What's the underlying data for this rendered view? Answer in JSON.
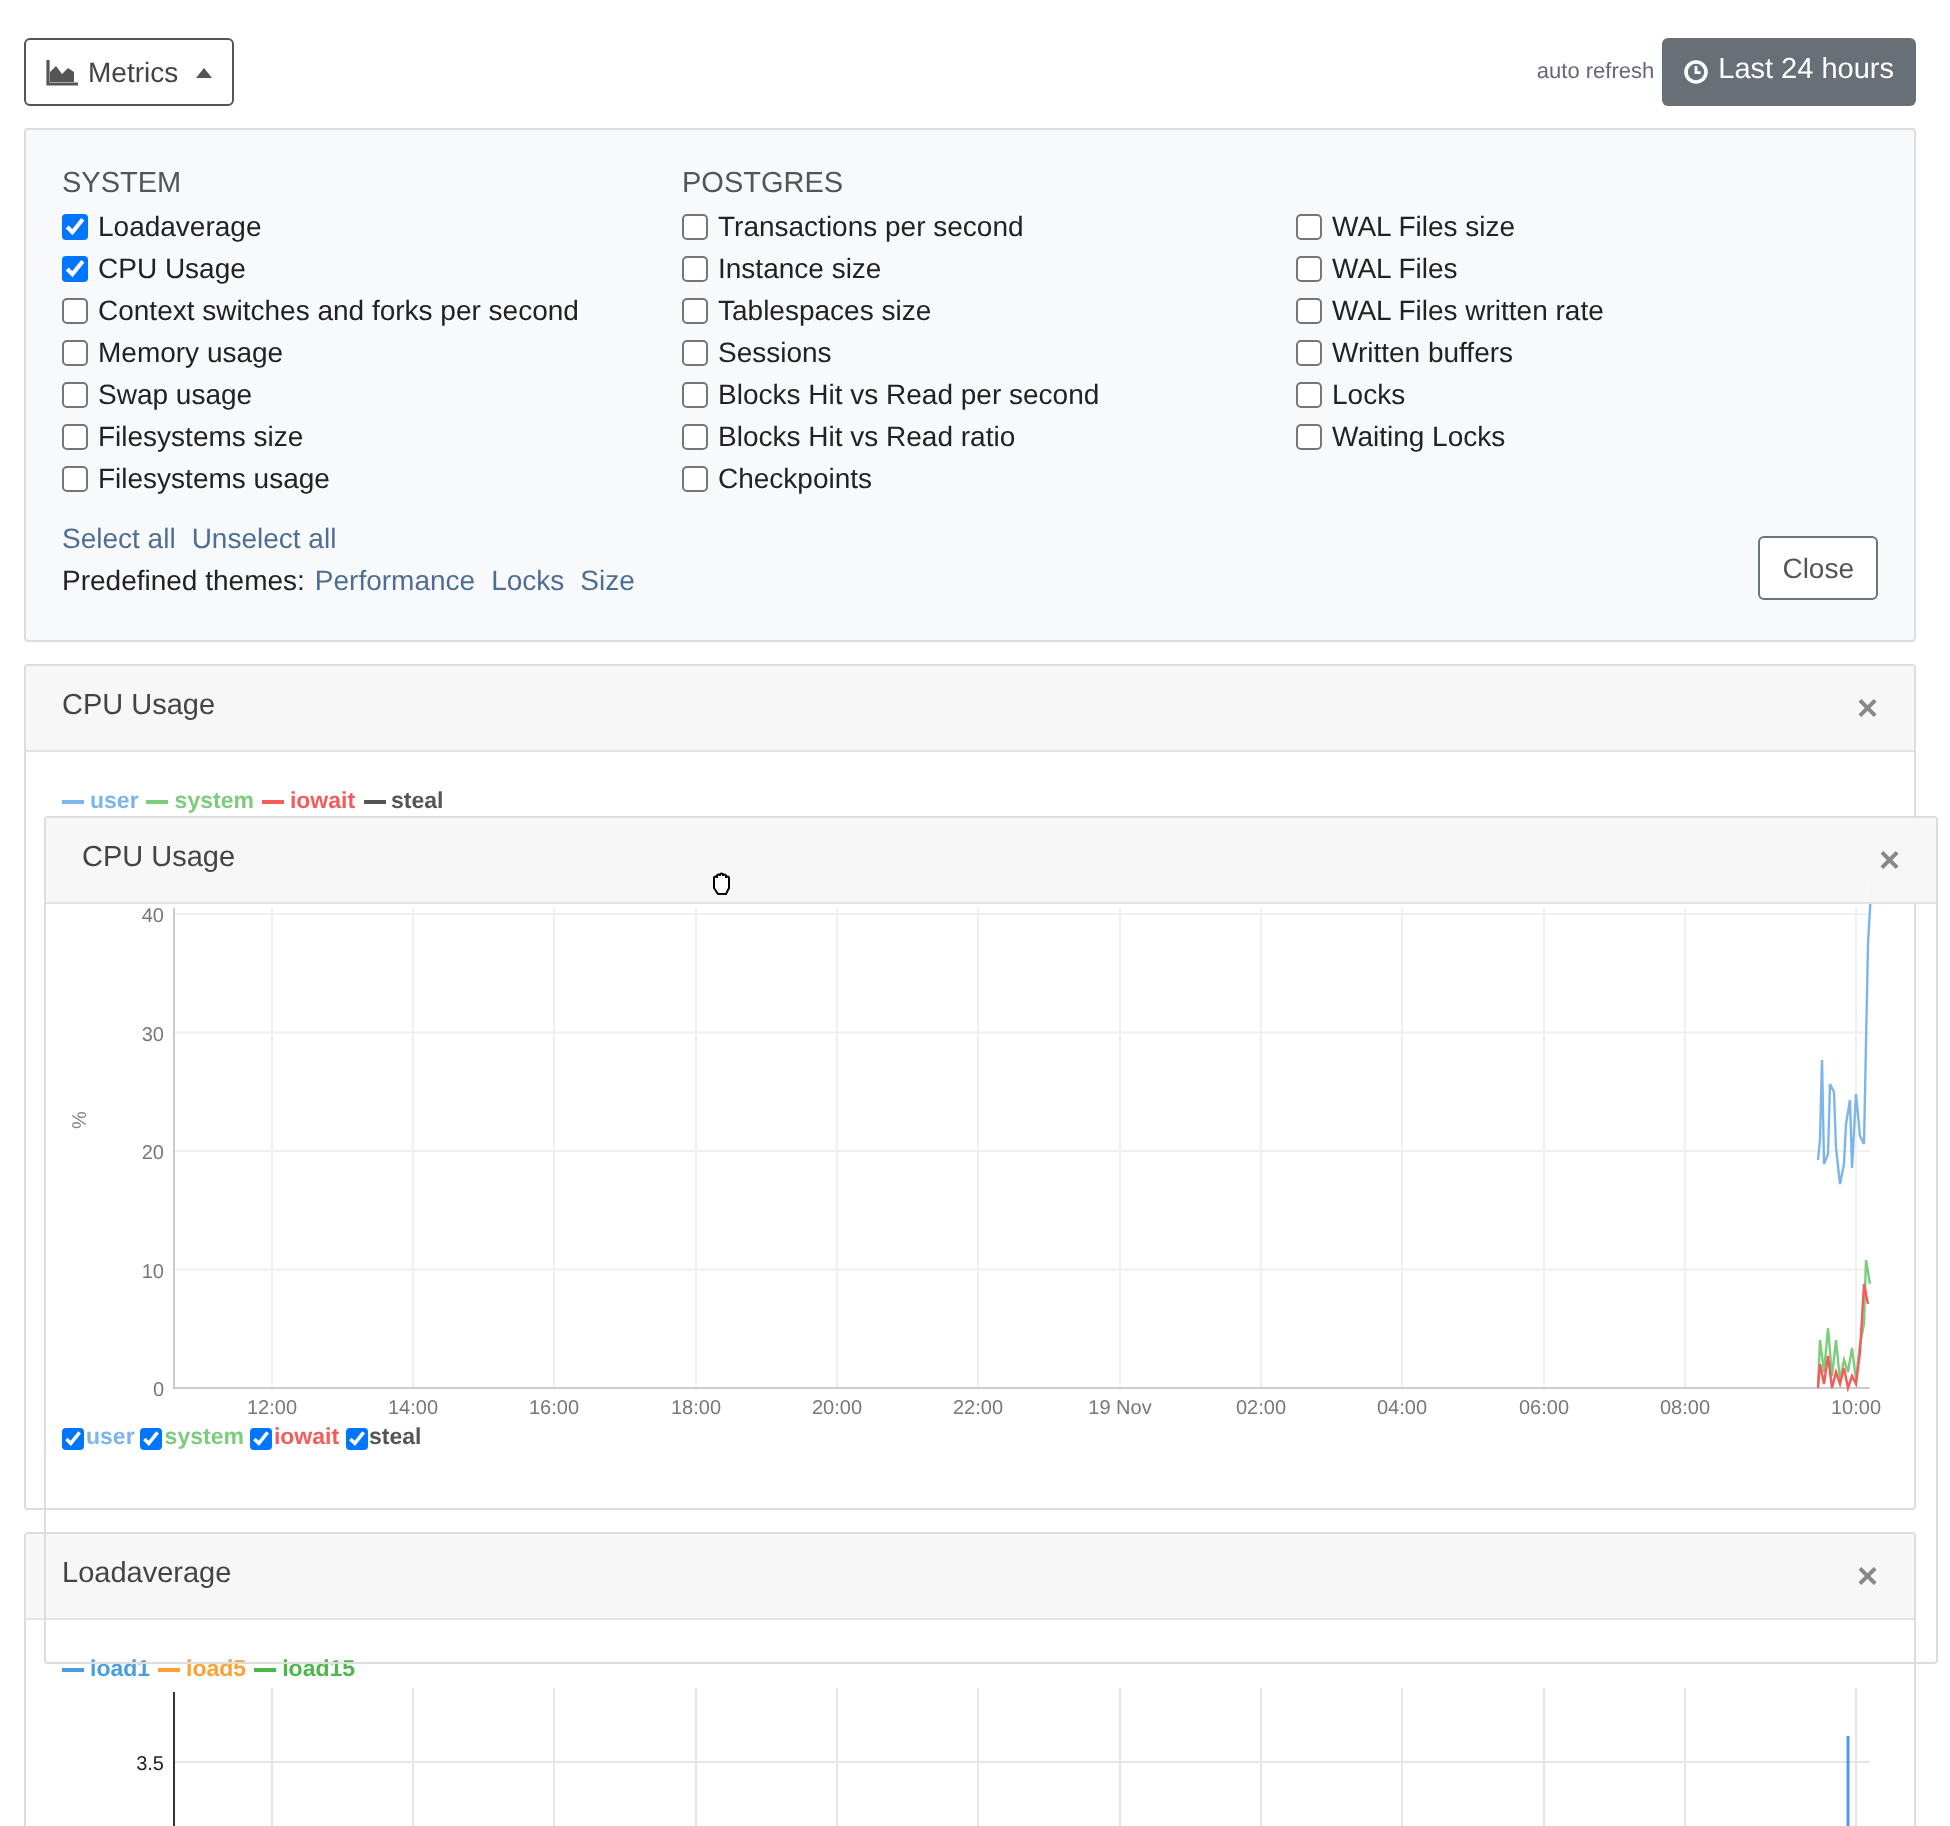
{
  "toolbar": {
    "metrics_button": {
      "label": "Metrics",
      "expanded": true
    },
    "auto_refresh": "auto refresh",
    "range_button": "Last 24 hours"
  },
  "metrics_panel": {
    "groups": [
      {
        "title": "SYSTEM",
        "items": [
          {
            "label": "Loadaverage",
            "checked": true
          },
          {
            "label": "CPU Usage",
            "checked": true
          },
          {
            "label": "Context switches and forks per second",
            "checked": false
          },
          {
            "label": "Memory usage",
            "checked": false
          },
          {
            "label": "Swap usage",
            "checked": false
          },
          {
            "label": "Filesystems size",
            "checked": false
          },
          {
            "label": "Filesystems usage",
            "checked": false
          }
        ]
      },
      {
        "title": "POSTGRES",
        "items": [
          {
            "label": "Transactions per second",
            "checked": false
          },
          {
            "label": "Instance size",
            "checked": false
          },
          {
            "label": "Tablespaces size",
            "checked": false
          },
          {
            "label": "Sessions",
            "checked": false
          },
          {
            "label": "Blocks Hit vs Read per second",
            "checked": false
          },
          {
            "label": "Blocks Hit vs Read ratio",
            "checked": false
          },
          {
            "label": "Checkpoints",
            "checked": false
          }
        ]
      },
      {
        "items": [
          {
            "label": "WAL Files size",
            "checked": false
          },
          {
            "label": "WAL Files",
            "checked": false
          },
          {
            "label": "WAL Files written rate",
            "checked": false
          },
          {
            "label": "Written buffers",
            "checked": false
          },
          {
            "label": "Locks",
            "checked": false
          },
          {
            "label": "Waiting Locks",
            "checked": false
          }
        ]
      }
    ],
    "select_all": "Select all",
    "unselect_all": "Unselect all",
    "themes_label": "Predefined themes:",
    "themes": [
      "Performance",
      "Locks",
      "Size"
    ],
    "close_button": "Close"
  },
  "panels": [
    {
      "title": "CPU Usage",
      "close": "×",
      "legend": [
        {
          "name": "user",
          "color": "#7cb5ec"
        },
        {
          "name": "system",
          "color": "#7dcc7d"
        },
        {
          "name": "iowait",
          "color": "#f45b5b"
        },
        {
          "name": "steal",
          "color": "#555555"
        }
      ],
      "chart": {
        "ylabel": "%",
        "yticks": [
          "40",
          "30",
          "20",
          "10",
          "0"
        ],
        "xticks": [
          "12:00",
          "14:00",
          "16:00",
          "18:00",
          "20:00",
          "22:00",
          "19 Nov",
          "02:00",
          "04:00",
          "06:00",
          "08:00",
          "10:00"
        ],
        "series_toggles": [
          {
            "name": "user",
            "checked": true,
            "color": "#7cb5ec"
          },
          {
            "name": "system",
            "checked": true,
            "color": "#7dcc7d"
          },
          {
            "name": "iowait",
            "checked": true,
            "color": "#f45b5b"
          },
          {
            "name": "steal",
            "checked": true,
            "color": "#555555"
          }
        ]
      }
    },
    {
      "title": "Loadaverage",
      "close": "×",
      "legend": [
        {
          "name": "load1",
          "color": "#4a9ee0"
        },
        {
          "name": "load5",
          "color": "#f7a235"
        },
        {
          "name": "load15",
          "color": "#4cb84c"
        }
      ],
      "chart": {
        "yticks": [
          "3.5"
        ]
      }
    }
  ],
  "drag_preview": {
    "title": "CPU Usage",
    "close": "×"
  }
}
